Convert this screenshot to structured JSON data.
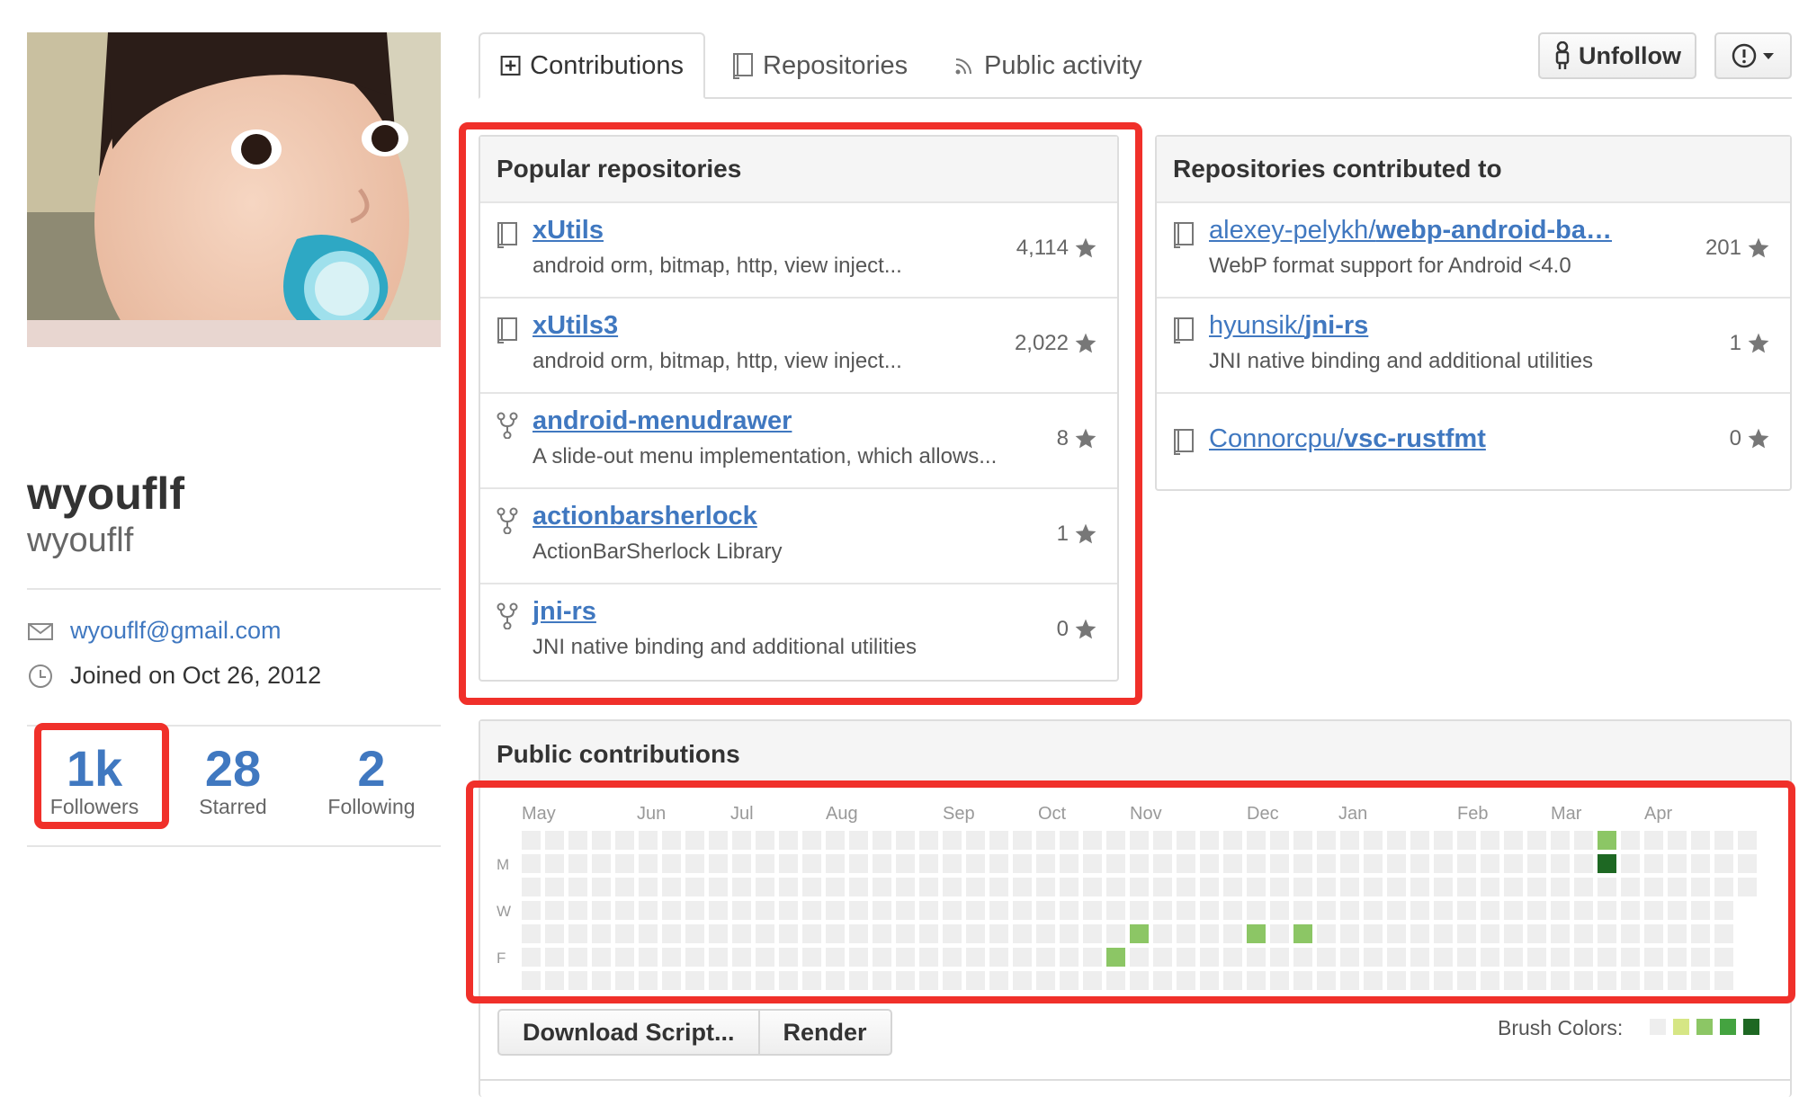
{
  "profile": {
    "fullname": "wyouflf",
    "username": "wyouflf",
    "email": "wyouflf@gmail.com",
    "joined": "Joined on Oct 26, 2012",
    "stats": [
      {
        "num": "1k",
        "label": "Followers"
      },
      {
        "num": "28",
        "label": "Starred"
      },
      {
        "num": "2",
        "label": "Following"
      }
    ]
  },
  "tabs": [
    {
      "label": "Contributions",
      "icon": "plus-box-icon",
      "selected": true
    },
    {
      "label": "Repositories",
      "icon": "book-icon"
    },
    {
      "label": "Public activity",
      "icon": "rss-icon"
    }
  ],
  "actions": {
    "unfollow": "Unfollow",
    "report": "exclamation-circle-icon"
  },
  "popular": {
    "title": "Popular repositories",
    "repos": [
      {
        "name": "xUtils",
        "desc": "android orm, bitmap, http, view inject...",
        "stars": "4,114",
        "icon": "repo-icon"
      },
      {
        "name": "xUtils3",
        "desc": "android orm, bitmap, http, view inject...",
        "stars": "2,022",
        "icon": "repo-icon"
      },
      {
        "name": "android-menudrawer",
        "desc": "A slide-out menu implementation, which allows...",
        "stars": "8",
        "icon": "fork-icon"
      },
      {
        "name": "actionbarsherlock",
        "desc": "ActionBarSherlock Library",
        "stars": "1",
        "icon": "fork-icon"
      },
      {
        "name": "jni-rs",
        "desc": "JNI native binding and additional utilities",
        "stars": "0",
        "icon": "fork-icon"
      }
    ]
  },
  "contributed": {
    "title": "Repositories contributed to",
    "repos": [
      {
        "owner": "alexey-pelykh/",
        "name": "webp-android-ba…",
        "desc": "WebP format support for Android <4.0",
        "stars": "201"
      },
      {
        "owner": "hyunsik/",
        "name": "jni-rs",
        "desc": "JNI native binding and additional utilities",
        "stars": "1"
      },
      {
        "owner": "Connorcpu/",
        "name": "vsc-rustfmt",
        "desc": "",
        "stars": "0"
      }
    ]
  },
  "contributions": {
    "title": "Public contributions",
    "months": [
      "May",
      "Jun",
      "Jul",
      "Aug",
      "Sep",
      "Oct",
      "Nov",
      "Dec",
      "Jan",
      "Feb",
      "Mar",
      "Apr"
    ],
    "days": [
      "M",
      "W",
      "F"
    ],
    "colors": {
      "empty": "#eeeeee",
      "l1": "#d6e685",
      "l2": "#8cc665",
      "l3": "#44a340",
      "l4": "#1e6823"
    },
    "active_cells": [
      {
        "week": 46,
        "day": 0,
        "level": "l2"
      },
      {
        "week": 46,
        "day": 1,
        "level": "l4"
      },
      {
        "week": 26,
        "day": 4,
        "level": "l2"
      },
      {
        "week": 25,
        "day": 5,
        "level": "l2"
      },
      {
        "week": 31,
        "day": 4,
        "level": "l2"
      },
      {
        "week": 33,
        "day": 4,
        "level": "l2"
      }
    ],
    "download_label": "Download Script...",
    "render_label": "Render",
    "brush_label": "Brush Colors:"
  }
}
